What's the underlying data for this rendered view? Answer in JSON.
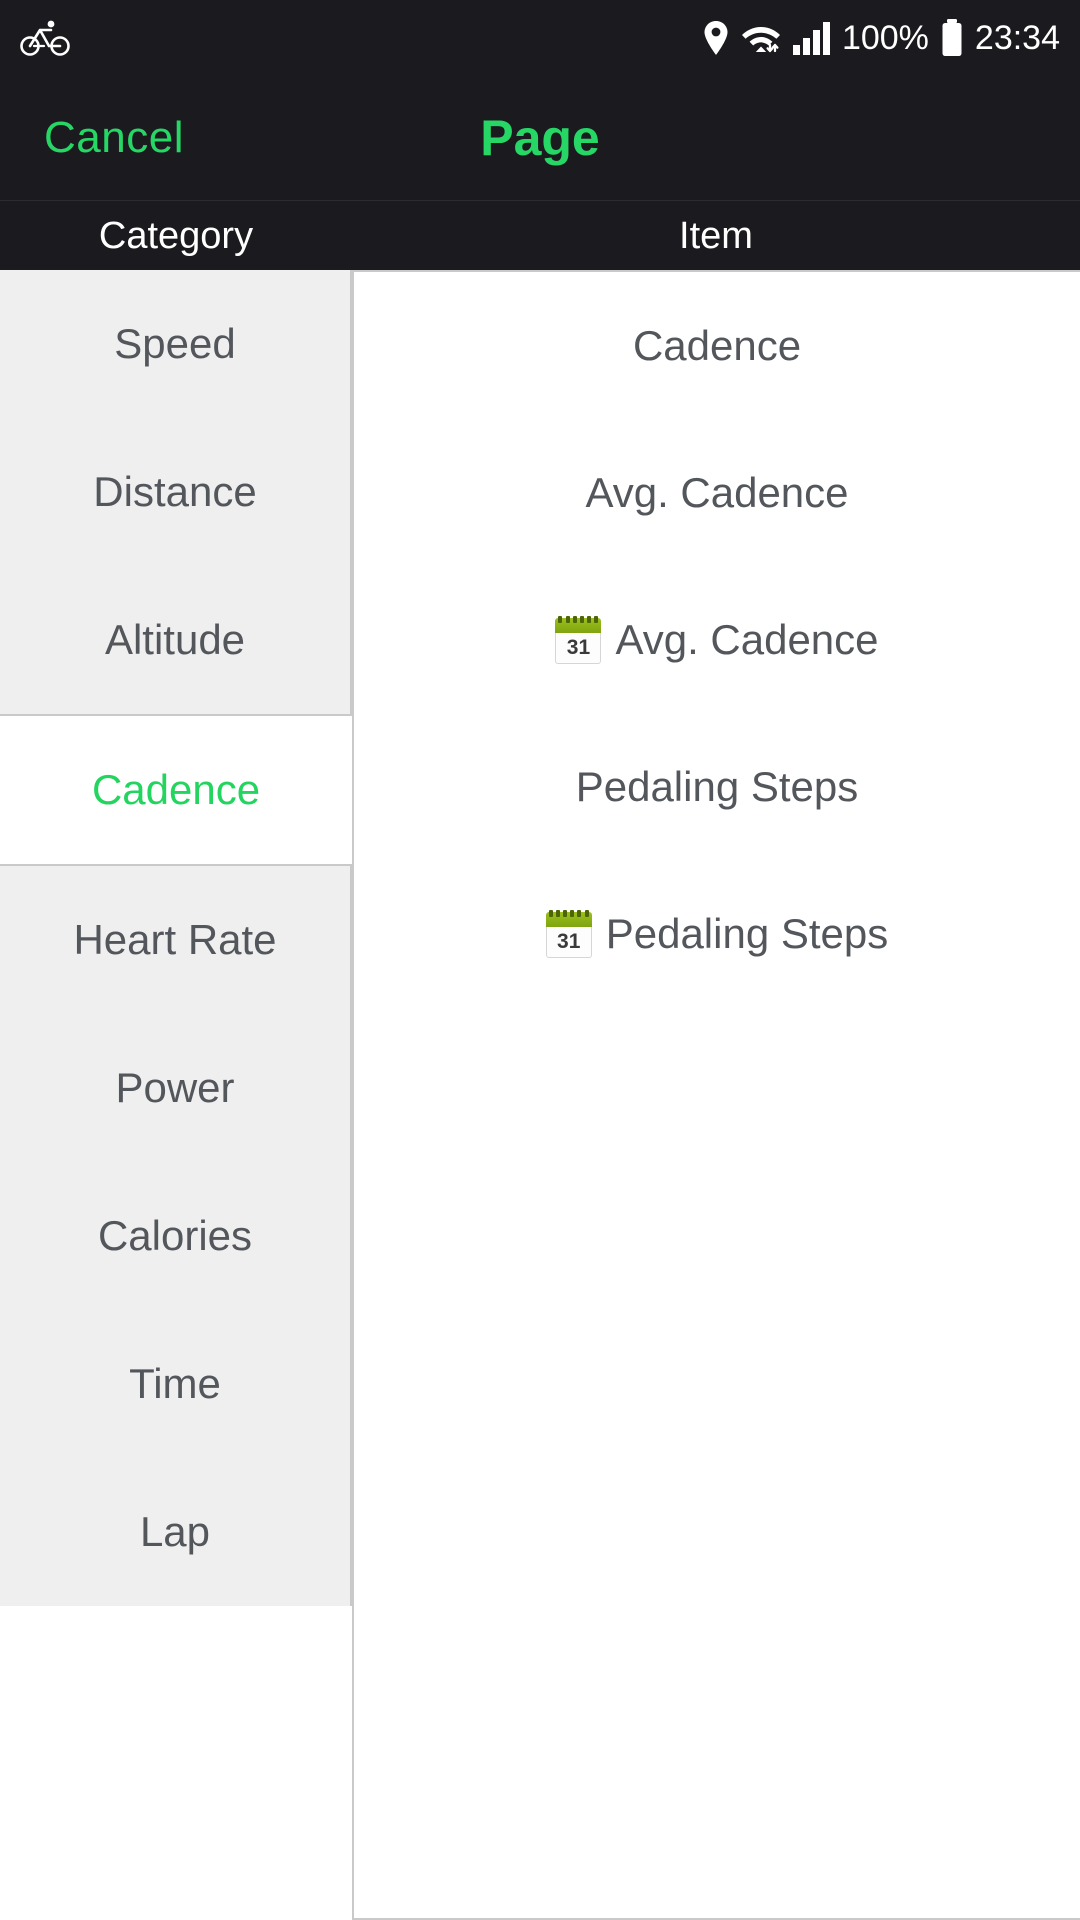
{
  "statusbar": {
    "left_icon": "bicycle-icon",
    "icons": [
      "location-pin-icon",
      "wifi-icon",
      "cellular-signal-icon"
    ],
    "battery_percent": "100%",
    "battery_icon": "battery-full-icon",
    "time": "23:34"
  },
  "navbar": {
    "cancel_label": "Cancel",
    "title": "Page",
    "accent_color": "#27d766",
    "background": "#1b1b1f"
  },
  "columns": {
    "category_header": "Category",
    "item_header": "Item"
  },
  "categories": [
    {
      "label": "Speed",
      "selected": false
    },
    {
      "label": "Distance",
      "selected": false
    },
    {
      "label": "Altitude",
      "selected": false
    },
    {
      "label": "Cadence",
      "selected": true
    },
    {
      "label": "Heart Rate",
      "selected": false
    },
    {
      "label": "Power",
      "selected": false
    },
    {
      "label": "Calories",
      "selected": false
    },
    {
      "label": "Time",
      "selected": false
    },
    {
      "label": "Lap",
      "selected": false
    }
  ],
  "items": [
    {
      "label": "Cadence",
      "icon": ""
    },
    {
      "label": "Avg. Cadence",
      "icon": ""
    },
    {
      "label": "Avg. Cadence",
      "icon": "calendar-icon",
      "icon_day": "31"
    },
    {
      "label": "Pedaling Steps",
      "icon": ""
    },
    {
      "label": "Pedaling Steps",
      "icon": "calendar-icon",
      "icon_day": "31"
    }
  ],
  "theme": {
    "selected_text_color": "#23d45f",
    "text_color": "#53575c",
    "row_background": "#efefef",
    "selected_background": "#ffffff",
    "border_color": "#c9c9c9"
  }
}
